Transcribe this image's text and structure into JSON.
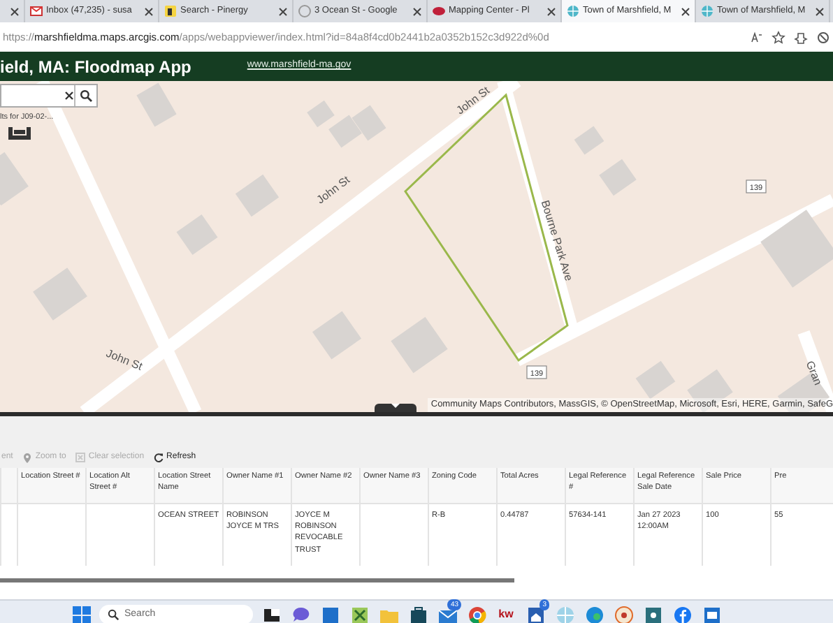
{
  "browser": {
    "tabs": [
      {
        "selected": false
      },
      {
        "kind": "mail",
        "title": "Inbox (47,235) - susa",
        "selected": false
      },
      {
        "kind": "letter",
        "title": "Search - Pinergy",
        "selected": false
      },
      {
        "kind": "pin",
        "title": "3 Ocean St - Google",
        "selected": false
      },
      {
        "kind": "logo",
        "title": "Mapping Center - Pl",
        "selected": false
      },
      {
        "kind": "globe",
        "title": "Town of Marshfield, M",
        "selected": true
      },
      {
        "kind": "globe",
        "title": "Town of Marshfield, M",
        "selected": false
      }
    ],
    "url": "https://**marshfieldma.maps.arcgis.com**/apps/webappviewer/index.html?id=84a8f4cd0b2441b2a0352b152c3d922d%0d"
  },
  "app_header": {
    "title": "ield, MA: Floodmap App",
    "link": "www.marshfield-ma.gov"
  },
  "map": {
    "search_hint": "lts for J09-02-...",
    "labels": [
      {
        "kind": "street",
        "text": "John St"
      },
      {
        "kind": "street",
        "text": "John St"
      },
      {
        "kind": "street",
        "text": "John St"
      },
      {
        "kind": "street",
        "text": "Bourne Park Ave"
      },
      {
        "kind": "street",
        "text": "Gran"
      },
      {
        "kind": "shield",
        "text": "139"
      },
      {
        "kind": "shield",
        "text": "139"
      }
    ],
    "attribution": "Community Maps Contributors, MassGIS, © OpenStreetMap, Microsoft, Esri, HERE, Garmin, SafeG"
  },
  "toolbar": [
    {
      "kind": "none",
      "label": "ent",
      "disabled": true
    },
    {
      "kind": "pin",
      "label": "Zoom to",
      "disabled": true
    },
    {
      "kind": "clear",
      "label": "Clear selection",
      "disabled": true
    },
    {
      "kind": "refresh",
      "label": "Refresh",
      "disabled": false
    }
  ],
  "table": {
    "columns": [
      "",
      "Location Street #",
      "Location Alt Street #",
      "Location Street Name",
      "Owner Name #1",
      "Owner Name #2",
      "Owner Name #3",
      "Zoning Code",
      "Total Acres",
      "Legal Reference #",
      "Legal Reference Sale Date",
      "Sale Price",
      "Pre"
    ],
    "rows": [
      [
        "",
        "",
        "",
        "OCEAN STREET",
        "ROBINSON JOYCE M TRS",
        "JOYCE M ROBINSON REVOCABLE TRUST",
        "",
        "R-B",
        "0.44787",
        "57634-141",
        "Jan 27 2023 12:00AM",
        "100",
        "55"
      ]
    ]
  },
  "taskbar": {
    "search_placeholder": "Search",
    "apps": [
      {
        "kind": "windows"
      },
      {
        "kind": "taskview"
      },
      {
        "kind": "chat"
      },
      {
        "kind": "tile"
      },
      {
        "kind": "excel"
      },
      {
        "kind": "folder"
      },
      {
        "kind": "briefcase"
      },
      {
        "kind": "mail",
        "badge": "43"
      },
      {
        "kind": "chrome"
      },
      {
        "kind": "text",
        "label": "kw"
      },
      {
        "kind": "home",
        "badge": "3"
      },
      {
        "kind": "globe"
      },
      {
        "kind": "edge"
      },
      {
        "kind": "paint"
      },
      {
        "kind": "network"
      },
      {
        "kind": "facebook"
      },
      {
        "kind": "window"
      }
    ]
  }
}
